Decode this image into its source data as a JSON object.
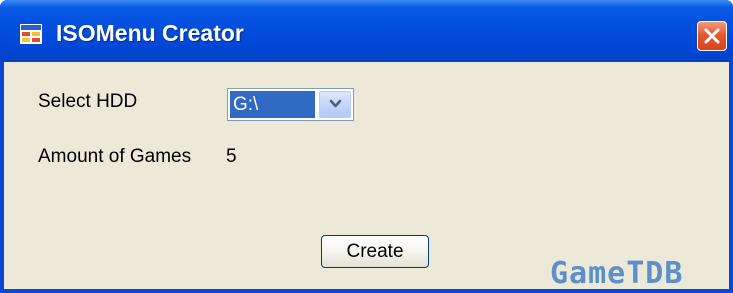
{
  "window": {
    "title": "ISOMenu Creator"
  },
  "form": {
    "select_hdd_label": "Select HDD",
    "select_hdd_value": "G:\\",
    "games_label": "Amount of Games",
    "games_count": "5",
    "create_button": "Create"
  },
  "watermark": "GameTDB",
  "colors": {
    "titlebar": "#0450de",
    "client_background": "#ece9d8",
    "selection": "#316ac5",
    "close_button": "#e55a33",
    "watermark": "#5d8fcb"
  },
  "icons": {
    "app": "window-app-icon",
    "close": "close-icon",
    "dropdown": "chevron-down-icon"
  }
}
